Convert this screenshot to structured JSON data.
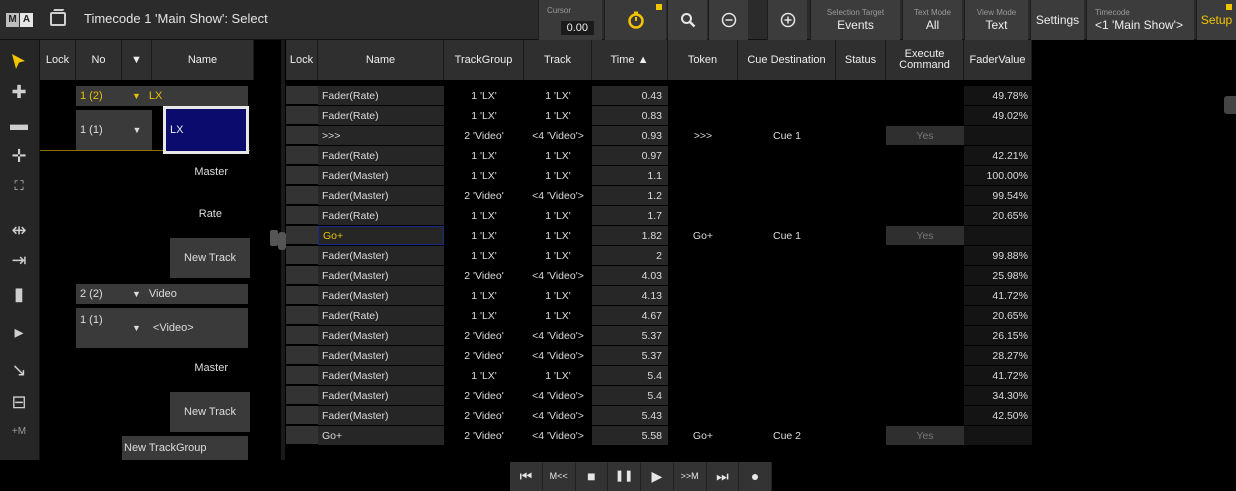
{
  "titlebar": {
    "logo_m": "M",
    "logo_a": "A",
    "title": "Timecode 1 'Main Show': Select",
    "cursor_label": "Cursor",
    "cursor_value": "0.00",
    "selection_target_label": "Selection Target",
    "selection_target_value": "Events",
    "text_mode_label": "Text Mode",
    "text_mode_value": "All",
    "view_mode_label": "View Mode",
    "view_mode_value": "Text",
    "settings_label": "Settings",
    "timecode_label": "Timecode",
    "timecode_value": "<1 'Main Show'>",
    "setup_label": "Setup",
    "accent_color": "#f2c300"
  },
  "toolbar": {
    "plus_label": "+M"
  },
  "tree": {
    "headers": {
      "lock": "Lock",
      "no": "No",
      "arrow": "▼",
      "name": "Name"
    },
    "rows": {
      "lx_no": "1 (2)",
      "lx_name": "LX",
      "lx_track_no": "1 (1)",
      "lx_track_name": "LX",
      "master1": "Master",
      "rate": "Rate",
      "newtrack1": "New Track",
      "video_no": "2 (2)",
      "video_name": "Video",
      "video_track_no": "1 (1)",
      "video_track_name": "<Video>",
      "master2": "Master",
      "newtrack2": "New Track",
      "newtrackgroup": "New TrackGroup"
    }
  },
  "sheet": {
    "headers": {
      "lock": "Lock",
      "name": "Name",
      "trackgroup": "TrackGroup",
      "track": "Track",
      "time": "Time ▲",
      "token": "Token",
      "cue_destination": "Cue Destination",
      "status": "Status",
      "execute_command": "Execute Command",
      "fadervalue": "FaderValue"
    },
    "rows": [
      {
        "name": "Fader(Rate)",
        "trackgroup": "1 'LX'",
        "track": "1 'LX'",
        "time": "0.43",
        "token": "",
        "cue": "",
        "exec": "",
        "fader": "49.78%"
      },
      {
        "name": "Fader(Rate)",
        "trackgroup": "1 'LX'",
        "track": "1 'LX'",
        "time": "0.83",
        "token": "",
        "cue": "",
        "exec": "",
        "fader": "49.02%"
      },
      {
        "name": ">>>",
        "trackgroup": "2 'Video'",
        "track": "<4 'Video'>",
        "time": "0.93",
        "token": ">>>",
        "cue": "Cue 1",
        "exec": "Yes",
        "fader": ""
      },
      {
        "name": "Fader(Rate)",
        "trackgroup": "1 'LX'",
        "track": "1 'LX'",
        "time": "0.97",
        "token": "",
        "cue": "",
        "exec": "",
        "fader": "42.21%"
      },
      {
        "name": "Fader(Master)",
        "trackgroup": "1 'LX'",
        "track": "1 'LX'",
        "time": "1.1",
        "token": "",
        "cue": "",
        "exec": "",
        "fader": "100.00%"
      },
      {
        "name": "Fader(Master)",
        "trackgroup": "2 'Video'",
        "track": "<4 'Video'>",
        "time": "1.2",
        "token": "",
        "cue": "",
        "exec": "",
        "fader": "99.54%"
      },
      {
        "name": "Fader(Rate)",
        "trackgroup": "1 'LX'",
        "track": "1 'LX'",
        "time": "1.7",
        "token": "",
        "cue": "",
        "exec": "",
        "fader": "20.65%"
      },
      {
        "name": "Go+",
        "trackgroup": "1 'LX'",
        "track": "1 'LX'",
        "time": "1.82",
        "token": "Go+",
        "cue": "Cue 1",
        "exec": "Yes",
        "fader": ""
      },
      {
        "name": "Fader(Master)",
        "trackgroup": "1 'LX'",
        "track": "1 'LX'",
        "time": "2",
        "token": "",
        "cue": "",
        "exec": "",
        "fader": "99.88%"
      },
      {
        "name": "Fader(Master)",
        "trackgroup": "2 'Video'",
        "track": "<4 'Video'>",
        "time": "4.03",
        "token": "",
        "cue": "",
        "exec": "",
        "fader": "25.98%"
      },
      {
        "name": "Fader(Master)",
        "trackgroup": "1 'LX'",
        "track": "1 'LX'",
        "time": "4.13",
        "token": "",
        "cue": "",
        "exec": "",
        "fader": "41.72%"
      },
      {
        "name": "Fader(Rate)",
        "trackgroup": "1 'LX'",
        "track": "1 'LX'",
        "time": "4.67",
        "token": "",
        "cue": "",
        "exec": "",
        "fader": "20.65%"
      },
      {
        "name": "Fader(Master)",
        "trackgroup": "2 'Video'",
        "track": "<4 'Video'>",
        "time": "5.37",
        "token": "",
        "cue": "",
        "exec": "",
        "fader": "26.15%"
      },
      {
        "name": "Fader(Master)",
        "trackgroup": "2 'Video'",
        "track": "<4 'Video'>",
        "time": "5.37",
        "token": "",
        "cue": "",
        "exec": "",
        "fader": "28.27%"
      },
      {
        "name": "Fader(Master)",
        "trackgroup": "1 'LX'",
        "track": "1 'LX'",
        "time": "5.4",
        "token": "",
        "cue": "",
        "exec": "",
        "fader": "41.72%"
      },
      {
        "name": "Fader(Master)",
        "trackgroup": "2 'Video'",
        "track": "<4 'Video'>",
        "time": "5.4",
        "token": "",
        "cue": "",
        "exec": "",
        "fader": "34.30%"
      },
      {
        "name": "Fader(Master)",
        "trackgroup": "2 'Video'",
        "track": "<4 'Video'>",
        "time": "5.43",
        "token": "",
        "cue": "",
        "exec": "",
        "fader": "42.50%"
      },
      {
        "name": "Go+",
        "trackgroup": "2 'Video'",
        "track": "<4 'Video'>",
        "time": "5.58",
        "token": "Go+",
        "cue": "Cue 2",
        "exec": "Yes",
        "fader": ""
      }
    ]
  },
  "playbar": {
    "prev": "⏮",
    "mback": "M<<",
    "stop": "■",
    "pause": "❚❚",
    "play": "▶",
    "mfwd": ">>M",
    "next": "⏭",
    "record": "●"
  }
}
